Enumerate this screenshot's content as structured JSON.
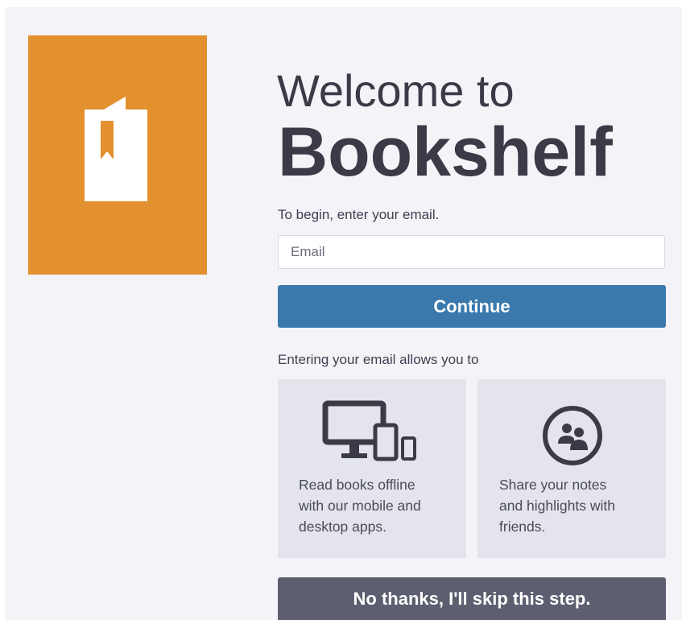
{
  "colors": {
    "brand_orange": "#e3902e",
    "primary_blue": "#3b79ad",
    "skip_gray": "#5d5f70",
    "text_dark": "#3a3b46",
    "background": "#f3f3f8",
    "card_background": "#e4e4ed"
  },
  "logo": {
    "icon": "book-bookmark-icon"
  },
  "header": {
    "welcome_line": "Welcome to",
    "app_name": "Bookshelf"
  },
  "form": {
    "prompt": "To begin, enter your email.",
    "email_value": "",
    "email_placeholder": "Email",
    "continue_label": "Continue"
  },
  "benefits": {
    "intro": "Entering your email allows you to",
    "items": [
      {
        "icon": "devices-icon",
        "text": "Read books offline\nwith our mobile and\ndesktop apps."
      },
      {
        "icon": "share-people-icon",
        "text": "Share your notes\nand highlights with\nfriends."
      }
    ]
  },
  "skip_label": "No thanks, I'll skip this step."
}
